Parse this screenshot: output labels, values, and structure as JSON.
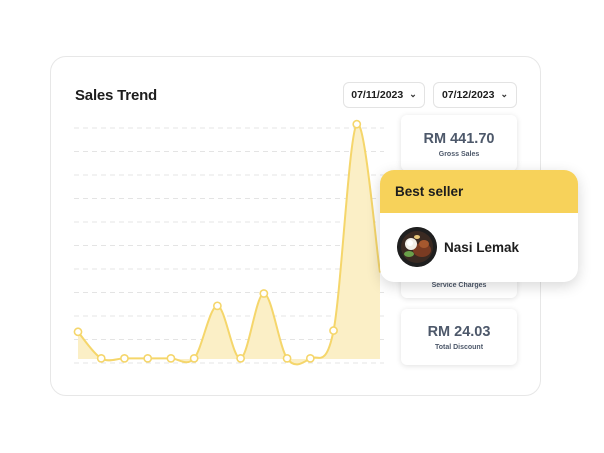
{
  "header": {
    "title": "Sales Trend"
  },
  "filters": {
    "start_date": "07/11/2023",
    "end_date": "07/12/2023"
  },
  "stats": [
    {
      "value": "RM 441.70",
      "label": "Gross Sales"
    },
    {
      "value": "",
      "label": "Service Charges"
    },
    {
      "value": "RM 24.03",
      "label": "Total Discount"
    }
  ],
  "best_seller": {
    "title": "Best seller",
    "item_name": "Nasi Lemak",
    "item_image_icon": "food-dish-icon"
  },
  "colors": {
    "accent": "#f7d25a",
    "line": "#f5d66b",
    "fill": "#fbefc6",
    "text": "#1d1d1d",
    "stat_text": "#4d586a"
  },
  "chart_data": {
    "type": "area",
    "title": "Sales Trend",
    "x": [
      0,
      1,
      2,
      3,
      4,
      5,
      6,
      7,
      8,
      9,
      10,
      11,
      12,
      13
    ],
    "values": [
      2.2,
      0.05,
      0.05,
      0.05,
      0.05,
      0.05,
      4.3,
      0.05,
      5.3,
      0.05,
      0.05,
      2.3,
      19.0,
      7.0
    ],
    "ylim": [
      0,
      19.5
    ],
    "grid": true,
    "show_axes": false
  }
}
